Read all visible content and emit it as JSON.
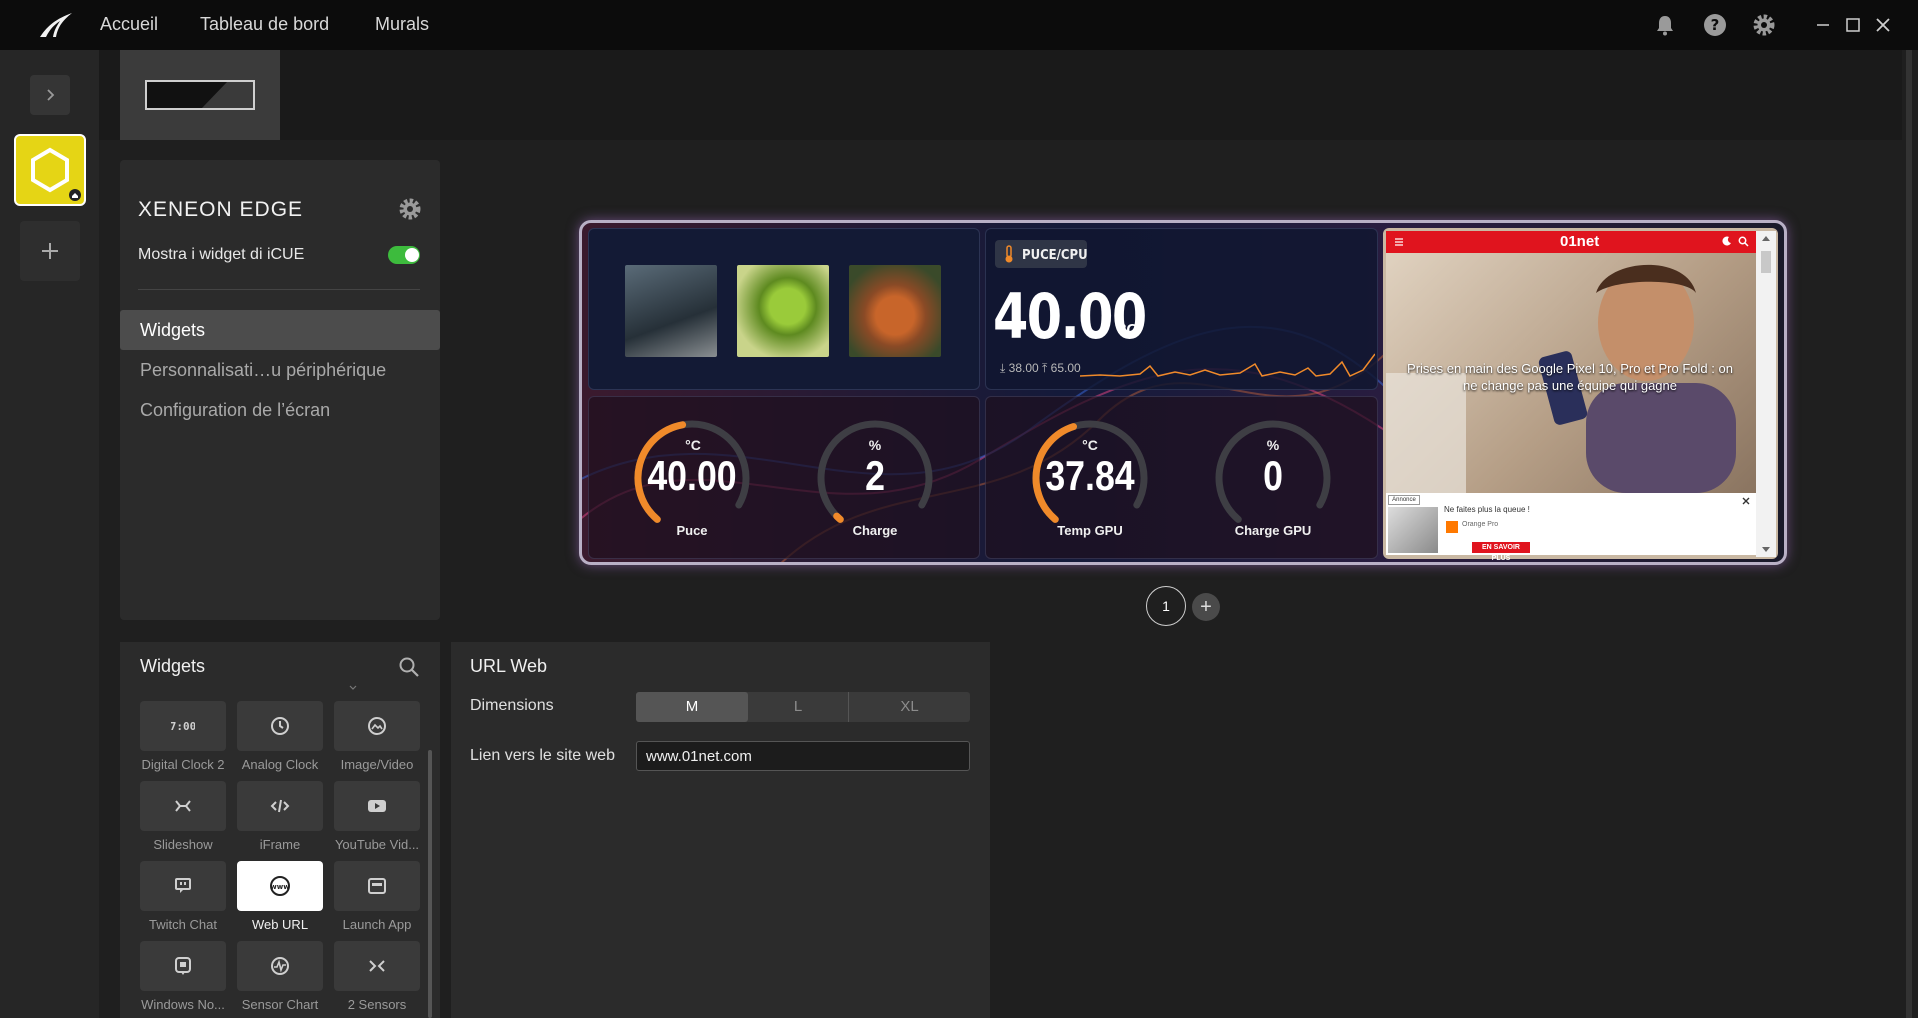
{
  "topbar": {
    "nav": [
      "Accueil",
      "Tableau de bord",
      "Murals"
    ]
  },
  "device": {
    "name": "XENEON EDGE",
    "show_widgets_label": "Mostra i widget di iCUE",
    "show_widgets_on": true,
    "menu": [
      "Widgets",
      "Personnalisati…u périphérique",
      "Configuration de l’écran"
    ]
  },
  "preview": {
    "cpu_label": "PUCE/CPU",
    "cpu_temp": "40.00",
    "cpu_unit": "°C",
    "cpu_min": "38.00",
    "cpu_max": "65.00",
    "gauges": [
      {
        "unit": "°C",
        "value": "40.00",
        "label": "Puce",
        "fraction": 0.5
      },
      {
        "unit": "%",
        "value": "2",
        "label": "Charge",
        "fraction": 0.02
      },
      {
        "unit": "°C",
        "value": "37.84",
        "label": "Temp GPU",
        "fraction": 0.47
      },
      {
        "unit": "%",
        "value": "0",
        "label": "Charge GPU",
        "fraction": 0.0
      }
    ],
    "web": {
      "logo": "01net",
      "headline": "Prises en main des Google Pixel 10, Pro et Pro Fold : on ne change pas une équipe qui gagne",
      "ad_label": "Annonce",
      "ad_text": "Ne faites plus la queue !",
      "ad_brand": "Orange Pro",
      "ad_cta": "EN SAVOIR PLUS"
    },
    "page": "1"
  },
  "palette": {
    "title": "Widgets",
    "items": [
      {
        "label": "Digital Clock 2",
        "icon": "digital-clock-icon"
      },
      {
        "label": "Analog Clock",
        "icon": "analog-clock-icon"
      },
      {
        "label": "Image/Video",
        "icon": "image-video-icon"
      },
      {
        "label": "Slideshow",
        "icon": "slideshow-icon"
      },
      {
        "label": "iFrame",
        "icon": "code-icon"
      },
      {
        "label": "YouTube Vid...",
        "icon": "youtube-icon"
      },
      {
        "label": "Twitch Chat",
        "icon": "twitch-chat-icon"
      },
      {
        "label": "Web URL",
        "icon": "www-icon",
        "selected": true
      },
      {
        "label": "Launch App",
        "icon": "launch-app-icon"
      },
      {
        "label": "Windows No...",
        "icon": "windows-notification-icon"
      },
      {
        "label": "Sensor Chart",
        "icon": "sensor-chart-icon"
      },
      {
        "label": "2 Sensors",
        "icon": "two-sensors-icon"
      }
    ]
  },
  "url_panel": {
    "title": "URL Web",
    "dimensions_label": "Dimensions",
    "sizes": [
      "M",
      "L",
      "XL"
    ],
    "selected_size": "M",
    "link_label": "Lien vers le site web",
    "link_value": "www.01net.com"
  }
}
